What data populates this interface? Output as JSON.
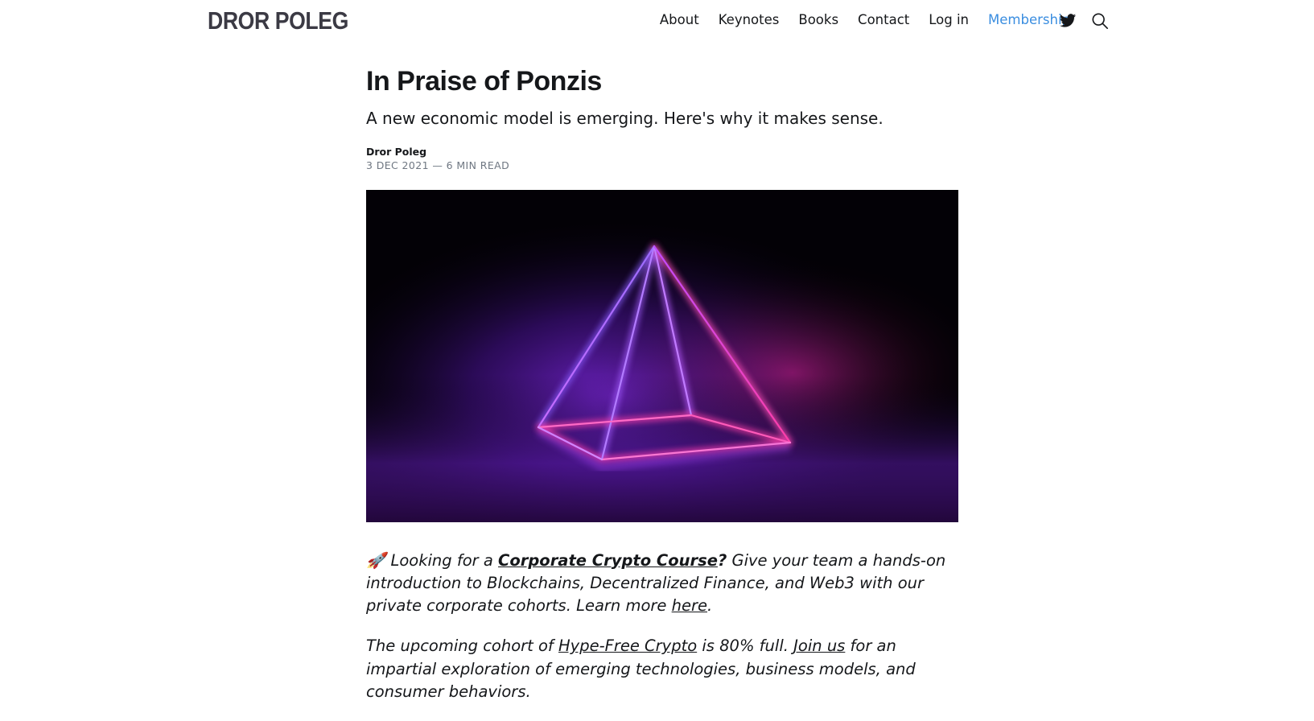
{
  "header": {
    "logo": "DROR POLEG",
    "nav": [
      "About",
      "Keynotes",
      "Books",
      "Contact",
      "Log in",
      "Membership"
    ],
    "icons": [
      "twitter-icon",
      "search-icon"
    ],
    "accent_color": "#3b8ee0"
  },
  "article": {
    "title": "In Praise of Ponzis",
    "subtitle": "A new economic model is emerging. Here's why it makes sense.",
    "author": "Dror Poleg",
    "meta": "3 DEC 2021 — 6 MIN READ"
  },
  "promo": {
    "p1": {
      "emoji": "🚀",
      "lead": " Looking for a ",
      "course_link": "Corporate Crypto Course",
      "question": "?",
      "body": " Give your team a hands-on introduction to Blockchains, Decentralized Finance, and Web3 with our private corporate cohorts. Learn more ",
      "here_link": "here",
      "end": "."
    },
    "p2": {
      "lead": "The upcoming cohort of ",
      "course_link": "Hype-Free Crypto",
      "mid": " is 80% full. ",
      "join_link": "Join us",
      "body": " for an impartial exploration of emerging technologies, business models, and consumer behaviors."
    }
  }
}
